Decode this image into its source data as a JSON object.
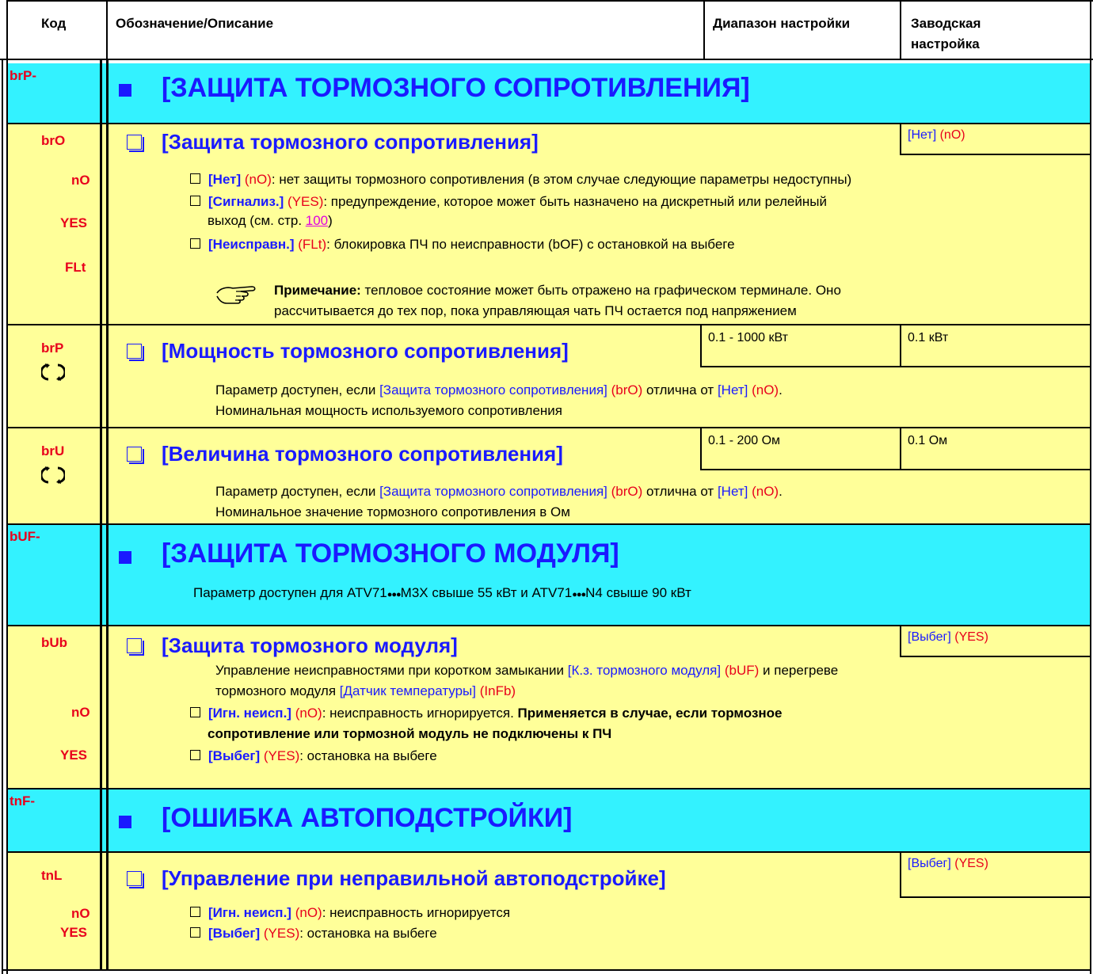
{
  "header": {
    "code": "Код",
    "description": "Обозначение/Описание",
    "range": "Диапазон настройки",
    "factory_line1": "Заводская",
    "factory_line2": "настройка"
  },
  "colors": {
    "section_bg": "#33f2ff",
    "param_bg": "#ffff99",
    "accent": "#1a1aff",
    "code": "#e8001c"
  },
  "sections": [
    {
      "code": "brP-",
      "title": "[ЗАЩИТА ТОРМОЗНОГО СОПРОТИВЛЕНИЯ]"
    },
    {
      "code": "bUF-",
      "title": "[ЗАЩИТА ТОРМОЗНОГО МОДУЛЯ]",
      "note_prefix": "Параметр доступен для ATV71",
      "note_dots": "●●●",
      "note_mid": "M3X свыше 55 кВт  и ATV71",
      "note_suffix": "N4 свыше 90 кВт"
    },
    {
      "code": "tnF-",
      "title": "[ОШИБКА АВТОПОДСТРОЙКИ]"
    }
  ],
  "brO": {
    "code": "brO",
    "title": "[Защита тормозного сопротивления]",
    "factory_name": "[Нет]",
    "factory_code": "(nO)",
    "opt1_code": "nO",
    "opt1_name": "[Нет]",
    "opt1_ref": "(nO)",
    "opt1_text": ": нет защиты тормозного сопротивления (в этом случае следующие параметры недоступны)",
    "opt2_code": "YES",
    "opt2_name": "[Сигнализ.]",
    "opt2_ref": "(YES)",
    "opt2_text": ": предупреждение, которое может быть назначено на дискретный или релейный",
    "opt2_text2": "выход (см. стр. ",
    "opt2_page": "100",
    "opt2_close": ")",
    "opt3_code": "FLt",
    "opt3_name": "[Неисправн.]",
    "opt3_ref": "(FLt)",
    "opt3_text": ": блокировка ПЧ по неисправности (bOF) с остановкой на выбеге",
    "note_label": "Примечание:",
    "note_text1": " тепловое состояние может быть отражено на графическом терминале. Оно",
    "note_text2": "рассчитывается до тех пор, пока управляющая чать ПЧ остается под напряжением"
  },
  "brP": {
    "code": "brP",
    "title": "[Мощность тормозного сопротивления]",
    "range": "0.1 - 1000 кВт",
    "factory": "0.1 кВт",
    "avail_prefix": "Параметр доступен, если ",
    "avail_name": "[Защита тормозного сопротивления]",
    "avail_code": "(brO)",
    "avail_mid": " отлична от ",
    "avail_name2": "[Нет]",
    "avail_code2": "(nO)",
    "avail_end": ".",
    "desc": "Номинальная мощность используемого сопротивления"
  },
  "brU": {
    "code": "brU",
    "title": "[Величина тормозного сопротивления]",
    "range": "0.1 - 200 Ом",
    "factory": "0.1 Ом",
    "avail_prefix": "Параметр доступен, если ",
    "avail_name": "[Защита тормозного сопротивления]",
    "avail_code": "(brO)",
    "avail_mid": " отлична от ",
    "avail_name2": "[Нет]",
    "avail_code2": "(nO)",
    "avail_end": ".",
    "desc": "Номинальное значение тормозного сопротивления в Ом"
  },
  "bUb": {
    "code": "bUb",
    "title": "[Защита тормозного модуля]",
    "factory_name": "[Выбег]",
    "factory_code": "(YES)",
    "text1_prefix": "Управление неисправностями при коротком замыкании ",
    "text1_name": "[К.з. тормозного модуля]",
    "text1_code": "(bUF)",
    "text1_end": " и перегреве",
    "text2_prefix": "тормозного модуля ",
    "text2_name": "[Датчик температуры]",
    "text2_code": "(InFb)",
    "opt1_code": "nO",
    "opt1_name": "[Игн. неисп.]",
    "opt1_ref": "(nO)",
    "opt1_text": ": неисправность игнорируется. ",
    "opt1_bold": "Применяется в случае, если тормозное",
    "opt1_bold2": "сопротивление или тормозной модуль не подключены к ПЧ",
    "opt2_code": "YES",
    "opt2_name": "[Выбег]",
    "opt2_ref": "(YES)",
    "opt2_text": ": остановка на выбеге"
  },
  "tnL": {
    "code": "tnL",
    "title": "[Управление при неправильной автоподстройке]",
    "factory_name": "[Выбег]",
    "factory_code": "(YES)",
    "opt1_code": "nO",
    "opt1_name": "[Игн. неисп.]",
    "opt1_ref": "(nO)",
    "opt1_text": ": неисправность игнорируется",
    "opt2_code": "YES",
    "opt2_name": "[Выбег]",
    "opt2_ref": "(YES)",
    "opt2_text": ": остановка на выбеге"
  },
  "icons": {
    "rotation": "rotation-icon",
    "hand": "pointing-hand-icon"
  }
}
